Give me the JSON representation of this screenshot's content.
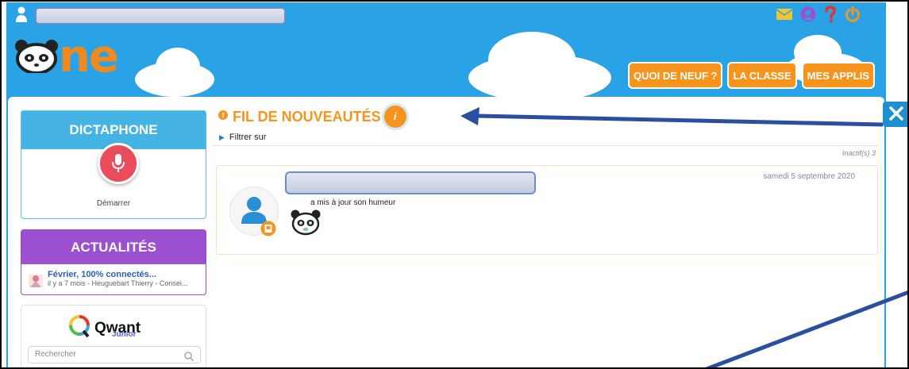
{
  "header": {
    "logo_text": "ne",
    "nav": [
      {
        "label": "QUOI DE NEUF ?"
      },
      {
        "label": "LA CLASSE"
      },
      {
        "label": "MES APPLIS"
      }
    ]
  },
  "icons": [
    "user-icon",
    "mail-icon",
    "account-icon",
    "help-icon",
    "power-icon",
    "tools-icon",
    "microphone-icon",
    "info-icon",
    "panda-mood-icon",
    "search-icon"
  ],
  "sidebar": {
    "dictaphone": {
      "title": "DICTAPHONE",
      "start_label": "Démarrer"
    },
    "actualites": {
      "title": "ACTUALITÉS",
      "item_title": "Février, 100% connectés...",
      "item_subtitle": "il y a 7 mois - Heuguebart Thierry - Consei..."
    },
    "qwant": {
      "brand": "Qwant",
      "sub": "Junior",
      "search_placeholder": "Rechercher"
    }
  },
  "feed": {
    "title": "FIL DE NOUVEAUTÉS",
    "info_label": "i",
    "filter_label": "Filtrer sur",
    "inactive_label": "Inactif(s) 3",
    "post": {
      "date": "samedi 5 septembre 2020",
      "text": "a mis à jour son humeur"
    }
  },
  "colors": {
    "brand_blue": "#29a3e6",
    "accent_orange": "#f7941d",
    "dictaphone_blue": "#45b4e5",
    "actualites_purple": "#9c4fcf",
    "mic_red": "#e94c5b"
  }
}
